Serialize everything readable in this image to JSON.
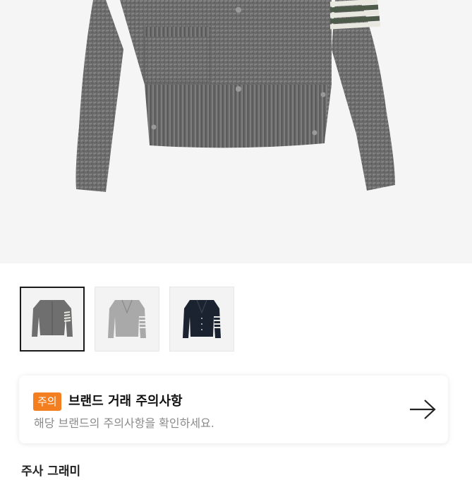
{
  "product": {
    "main_image_icon": "grey-cardigan-photo",
    "thumbnails": [
      {
        "icon": "grey-cardigan-thumb",
        "selected": true
      },
      {
        "icon": "light-grey-cardigan-thumb",
        "selected": false
      },
      {
        "icon": "navy-cardigan-thumb",
        "selected": false
      }
    ]
  },
  "notice": {
    "badge": "주의",
    "title": "브랜드 거래 주의사항",
    "description": "해당 브랜드의 주의사항을 확인하세요.",
    "arrow_icon": "arrow-right-icon",
    "badge_color": "#f47f20"
  },
  "footer": {
    "partial_text": "주사 그래미"
  }
}
